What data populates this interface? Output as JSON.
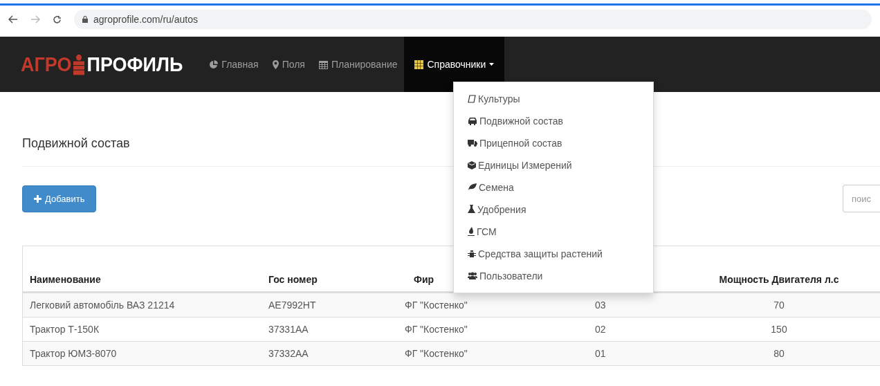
{
  "browser": {
    "url": "agroprofile.com/ru/autos"
  },
  "navbar": {
    "brand": {
      "left": "АГРО",
      "right": "ПРОФИЛЬ"
    },
    "items": [
      {
        "label": "Главная",
        "selected": false
      },
      {
        "label": "Поля",
        "selected": false
      },
      {
        "label": "Планирование",
        "selected": false
      },
      {
        "label": "Справочники",
        "selected": true,
        "expanded": true
      }
    ]
  },
  "dropdown": [
    {
      "label": "Культуры"
    },
    {
      "label": "Подвижной состав"
    },
    {
      "label": "Прицепной состав"
    },
    {
      "label": "Единицы Измерений"
    },
    {
      "label": "Семена"
    },
    {
      "label": "Удобрения"
    },
    {
      "label": "ГСМ"
    },
    {
      "label": "Средства защиты растений"
    },
    {
      "label": "Пользователи"
    }
  ],
  "page": {
    "title": "Подвижной состав",
    "add_button": "Добавить",
    "search": {
      "placeholder": "поис"
    }
  },
  "table": {
    "columns": [
      "Наименование",
      "Гос номер",
      "Фир",
      "",
      "Мощность Двигателя л.с"
    ],
    "rows": [
      [
        "Легковий автомобіль ВАЗ 21214",
        "AE7992HT",
        "ФГ \"Костенко\"",
        "03",
        "70"
      ],
      [
        "Трактор Т-150К",
        "37331AA",
        "ФГ \"Костенко\"",
        "02",
        "150"
      ],
      [
        "Трактор ЮМЗ-8070",
        "37332AA",
        "ФГ \"Костенко\"",
        "01",
        "80"
      ]
    ]
  }
}
